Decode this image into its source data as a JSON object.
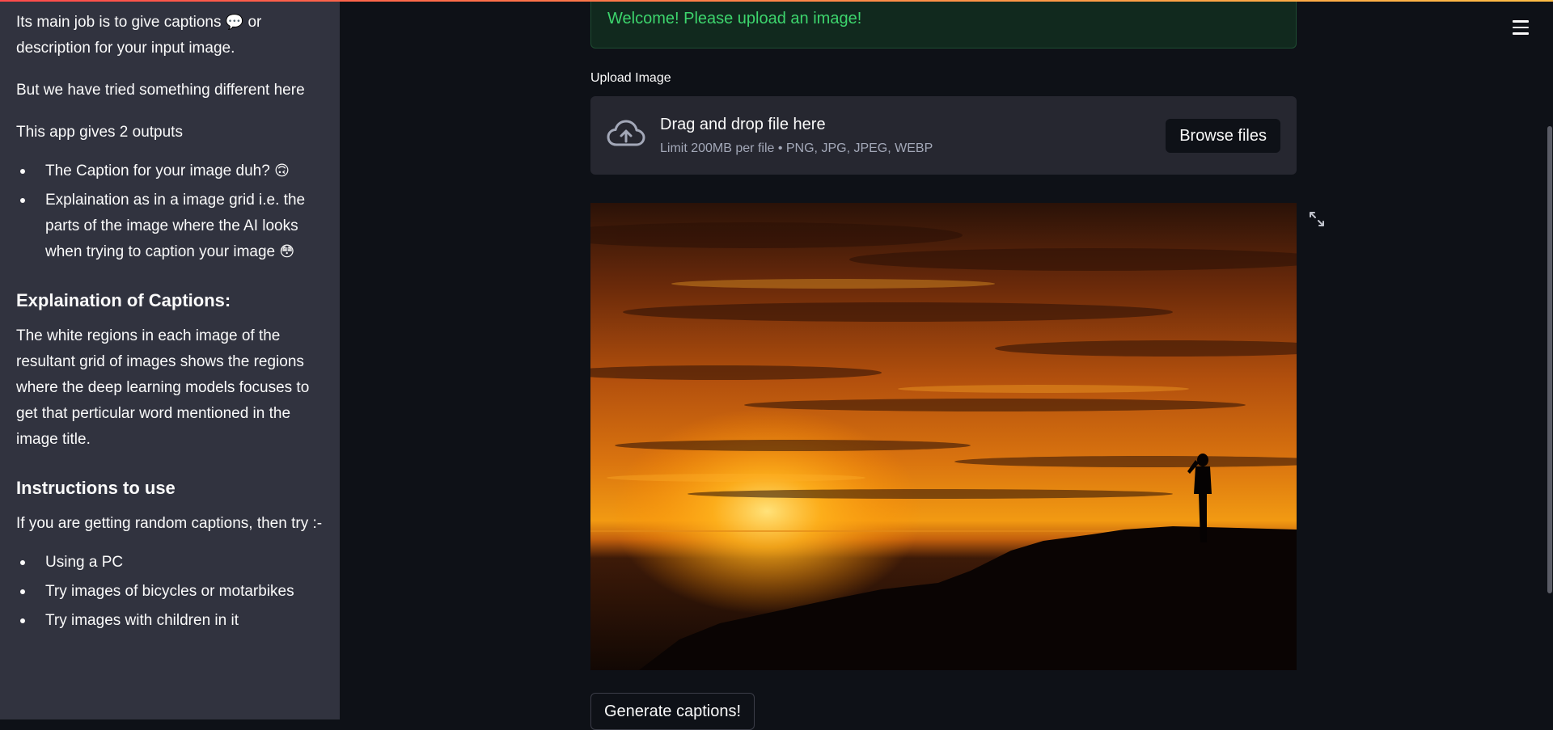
{
  "sidebar": {
    "intro": "Its main job is to give captions",
    "intro_emoji": "💬",
    "intro_tail": "or description for your input image.",
    "p2": "But we have tried something different here",
    "p3": "This app gives 2 outputs",
    "outputs": [
      {
        "text": "The Caption for your image duh?",
        "emoji": "🙃"
      },
      {
        "text": "Explaination as in a image grid i.e. the parts of the image where the AI looks when trying to caption your image",
        "emoji": "😳"
      }
    ],
    "heading_captions": "Explaination of Captions:",
    "captions_text": "The white regions in each image of the resultant grid of images shows the regions where the deep learning models focuses to get that perticular word mentioned in the image title.",
    "heading_instructions": "Instructions to use",
    "instructions_text": "If you are getting random captions, then try :-",
    "tips": [
      "Using a PC",
      "Try images of bicycles or motarbikes",
      "Try images with children in it"
    ]
  },
  "main": {
    "welcome": "Welcome! Please upload an image!",
    "upload_label": "Upload Image",
    "dropzone_title": "Drag and drop file here",
    "dropzone_sub": "Limit 200MB per file • PNG, JPG, JPEG, WEBP",
    "browse_label": "Browse files",
    "generate_label": "Generate captions!"
  },
  "icons": {
    "menu": "hamburger-menu-icon",
    "upload": "cloud-upload-icon",
    "expand": "fullscreen-expand-icon"
  },
  "colors": {
    "background": "#0e1117",
    "sidebar": "#31333f",
    "success_text": "#3dd56d",
    "success_bg": "#11291e",
    "dropzone": "#262730"
  }
}
